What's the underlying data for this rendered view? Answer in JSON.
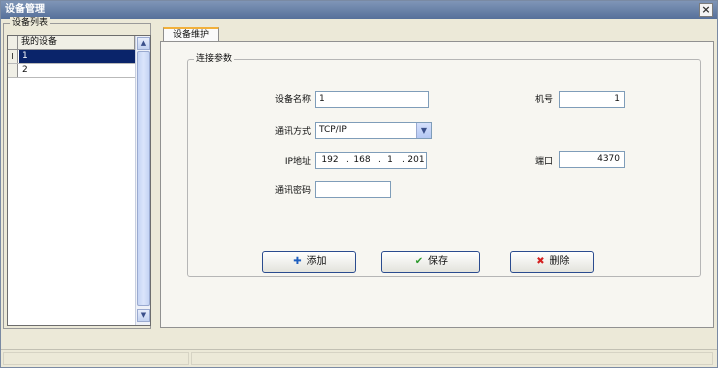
{
  "window": {
    "title": "设备管理",
    "close_symbol": "×"
  },
  "device_list": {
    "group_title": "设备列表",
    "column_header": "我的设备",
    "rows": [
      {
        "marker": "I",
        "label": "1",
        "selected": true
      },
      {
        "marker": "",
        "label": "2",
        "selected": false
      }
    ]
  },
  "tab": {
    "label": "设备维护"
  },
  "connection": {
    "group_title": "连接参数",
    "device_name_label": "设备名称",
    "device_name_value": "1",
    "machine_no_label": "机号",
    "machine_no_value": "1",
    "comm_mode_label": "通讯方式",
    "comm_mode_value": "TCP/IP",
    "ip_label": "IP地址",
    "ip_segments": [
      "192",
      "168",
      "1",
      "201"
    ],
    "port_label": "端口",
    "port_value": "4370",
    "comm_password_label": "通讯密码",
    "comm_password_value": ""
  },
  "buttons": {
    "add_label": "添加",
    "save_label": "保存",
    "delete_label": "删除"
  },
  "icons": {
    "add": "plus-icon",
    "save": "check-icon",
    "delete": "x-icon",
    "scroll_up": "chevron-up-icon",
    "scroll_down": "chevron-down-icon",
    "combo": "chevron-down-icon"
  },
  "colors": {
    "add": "#1f5fbf",
    "save": "#2e9a2e",
    "delete": "#d42020",
    "tab_accent": "#f2b03a",
    "selection": "#0a246a"
  }
}
